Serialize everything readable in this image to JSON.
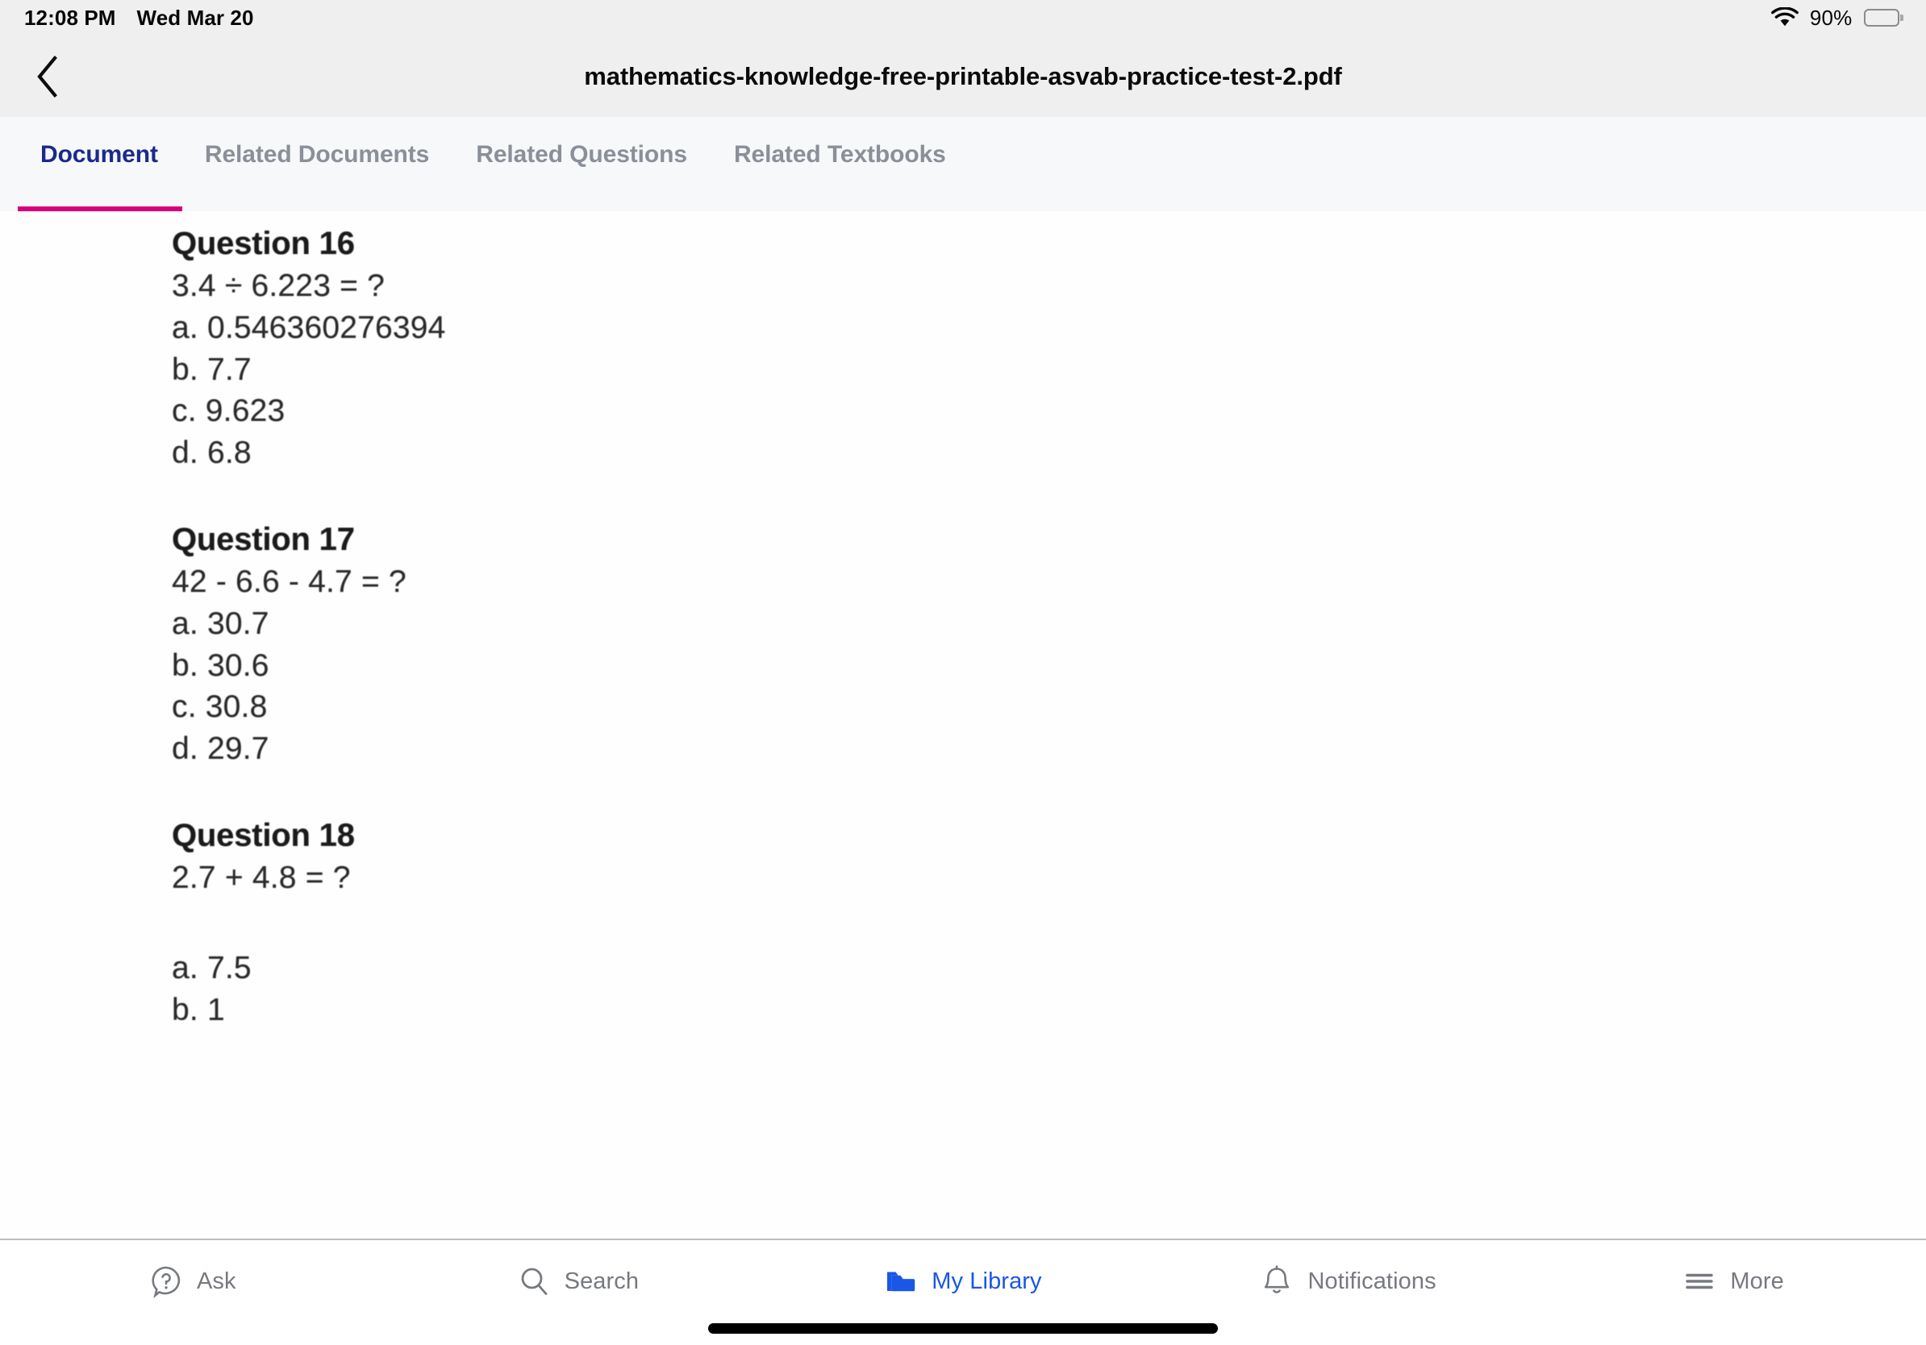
{
  "status_bar": {
    "time": "12:08 PM",
    "date": "Wed Mar 20",
    "wifi_icon": "wifi-icon",
    "battery_percent": "90%",
    "battery_icon": "battery-icon"
  },
  "header": {
    "back_icon": "chevron-left-icon",
    "title": "mathematics-knowledge-free-printable-asvab-practice-test-2.pdf"
  },
  "tabs": {
    "active_index": 0,
    "active_color": "#1a2a8c",
    "inactive_color": "#8a8f98",
    "underline_color": "#d6007f",
    "items": [
      {
        "label": "Document"
      },
      {
        "label": "Related Documents"
      },
      {
        "label": "Related Questions"
      },
      {
        "label": "Related Textbooks"
      }
    ]
  },
  "document": {
    "questions": [
      {
        "title": "Question 16",
        "prompt": "3.4 ÷ 6.223 = ?",
        "gap_before_options": false,
        "options": [
          "a. 0.546360276394",
          "b. 7.7",
          "c. 9.623",
          "d. 6.8"
        ]
      },
      {
        "title": "Question 17",
        "prompt": "42 - 6.6 - 4.7 = ?",
        "gap_before_options": false,
        "options": [
          "a. 30.7",
          "b. 30.6",
          "c. 30.8",
          "d. 29.7"
        ]
      },
      {
        "title": "Question 18",
        "prompt": "2.7 + 4.8 = ?",
        "gap_before_options": true,
        "options": [
          "a. 7.5",
          "b. 1"
        ]
      }
    ]
  },
  "bottom_nav": {
    "active_index": 2,
    "active_color": "#1a56e8",
    "inactive_color": "#76797f",
    "items": [
      {
        "label": "Ask",
        "icon": "question-bubble-icon"
      },
      {
        "label": "Search",
        "icon": "search-icon"
      },
      {
        "label": "My Library",
        "icon": "folder-icon"
      },
      {
        "label": "Notifications",
        "icon": "bell-icon"
      },
      {
        "label": "More",
        "icon": "hamburger-menu-icon"
      }
    ]
  }
}
